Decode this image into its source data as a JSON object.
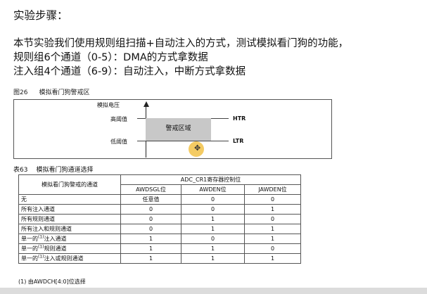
{
  "slide": {
    "title": "实验步骤：",
    "lines": [
      "本节实验我们使用规则组扫描+自动注入的方式，测试模拟看门狗的功能，",
      "规则组6个通道（0-5）：DMA的方式拿数据",
      "注入组4个通道（6-9）：自动注入，中断方式拿数据"
    ]
  },
  "figure": {
    "label": "图26",
    "title": "模拟看门狗警戒区",
    "y_axis_label": "模拟电压",
    "high_threshold_label": "高阈值",
    "low_threshold_label": "低阈值",
    "zone_label": "警戒区域",
    "htr": "HTR",
    "ltr": "LTR"
  },
  "table": {
    "label": "表63",
    "title": "模拟看门狗通道选择",
    "row_header": "模拟看门狗警戒的通道",
    "group_header": "ADC_CR1寄存器控制位",
    "columns": [
      "AWDSGL位",
      "AWDEN位",
      "JAWDEN位"
    ],
    "rows": [
      {
        "pre": "无",
        "sup": "",
        "post": "",
        "values": [
          "任意值",
          "0",
          "0"
        ]
      },
      {
        "pre": "所有注入通道",
        "sup": "",
        "post": "",
        "values": [
          "0",
          "0",
          "1"
        ]
      },
      {
        "pre": "所有规则通道",
        "sup": "",
        "post": "",
        "values": [
          "0",
          "1",
          "0"
        ]
      },
      {
        "pre": "所有注入和规则通道",
        "sup": "",
        "post": "",
        "values": [
          "0",
          "1",
          "1"
        ]
      },
      {
        "pre": "单一的",
        "sup": "(1)",
        "post": "注入通道",
        "values": [
          "1",
          "0",
          "1"
        ]
      },
      {
        "pre": "单一的",
        "sup": "(1)",
        "post": "规则通道",
        "values": [
          "1",
          "1",
          "0"
        ]
      },
      {
        "pre": "单一的",
        "sup": "(1)",
        "post": "注入或规则通道",
        "values": [
          "1",
          "1",
          "1"
        ]
      }
    ],
    "footnote": "(1) 由AWDCH[4:0]位选择"
  }
}
